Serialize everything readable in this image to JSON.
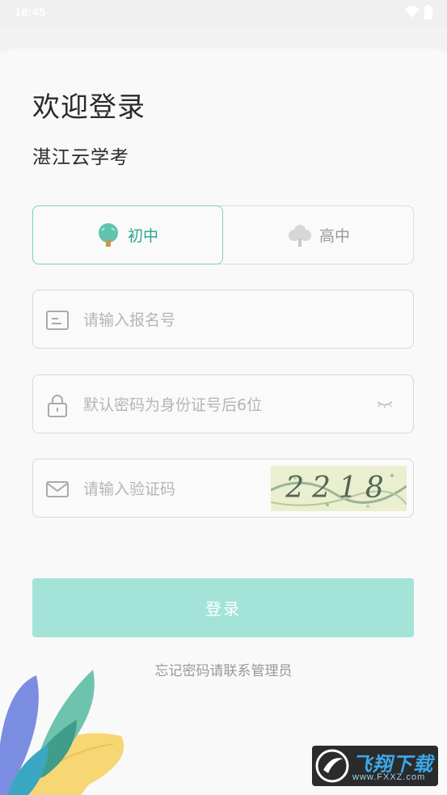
{
  "status_bar": {
    "time": "16:45",
    "icons": [
      "wifi-icon",
      "battery-icon"
    ]
  },
  "header": {
    "title": "欢迎登录",
    "subtitle": "湛江云学考"
  },
  "level": {
    "options": [
      {
        "label": "初中",
        "icon": "tree-green-icon",
        "selected": true
      },
      {
        "label": "高中",
        "icon": "tree-grey-icon",
        "selected": false
      }
    ]
  },
  "form": {
    "reg_number": {
      "placeholder": "请输入报名号",
      "value": "",
      "icon": "id-card-icon"
    },
    "password": {
      "placeholder": "默认密码为身份证号后6位",
      "value": "",
      "icon": "lock-icon",
      "toggle_icon": "eye-closed-icon"
    },
    "captcha": {
      "placeholder": "请输入验证码",
      "value": "",
      "icon": "mail-icon",
      "image_text": "2218"
    }
  },
  "login_button": "登录",
  "forgot_text": "忘记密码请联系管理员",
  "watermark": {
    "text": "飞翔下载",
    "url": "www.FXXZ.com"
  },
  "colors": {
    "accent": "#2aa58f",
    "button": "#a3e3d8",
    "border": "#d8d8d8"
  }
}
